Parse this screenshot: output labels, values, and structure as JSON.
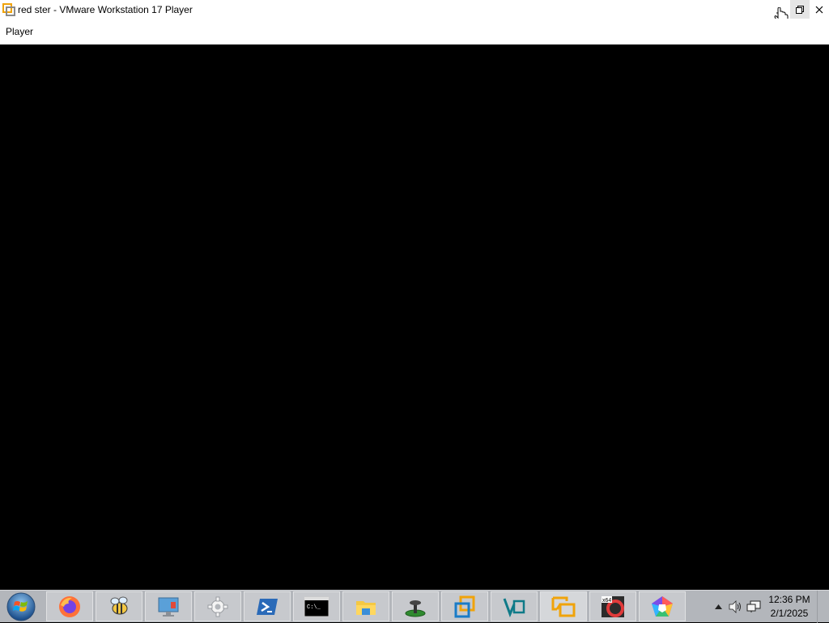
{
  "window": {
    "title": "red ster - VMware Workstation 17 Player",
    "icon": "vmware-logo-icon",
    "controls": [
      "minimize-icon",
      "maximize-icon",
      "close-icon"
    ]
  },
  "menubar": {
    "player_label": "Player"
  },
  "vm_screen": {
    "background": "#000000"
  },
  "taskbar": {
    "start_icon": "windows-start-orb-icon",
    "apps": [
      {
        "name": "firefox",
        "icon": "firefox-icon"
      },
      {
        "name": "bee",
        "icon": "bee-app-icon"
      },
      {
        "name": "computer",
        "icon": "computer-monitor-icon"
      },
      {
        "name": "settings",
        "icon": "gear-icon"
      },
      {
        "name": "powershell",
        "icon": "powershell-icon"
      },
      {
        "name": "cmd",
        "icon": "command-prompt-icon"
      },
      {
        "name": "explorer",
        "icon": "file-explorer-icon"
      },
      {
        "name": "stand",
        "icon": "green-stand-icon"
      },
      {
        "name": "virtualbox",
        "icon": "overlapping-squares-icon"
      },
      {
        "name": "visualstudio",
        "icon": "vs-logo-icon"
      },
      {
        "name": "vmware",
        "icon": "vmware-logo-icon"
      },
      {
        "name": "x64dbg",
        "icon": "x64dbg-icon"
      },
      {
        "name": "colorful",
        "icon": "pentagon-app-icon"
      }
    ],
    "tray_icons": [
      "show-hidden-icons-chevron",
      "speaker-icon",
      "network-icon"
    ],
    "clock": {
      "time": "12:36 PM",
      "date": "2/1/2025"
    }
  },
  "colors": {
    "vmware_orange": "#f0a30a",
    "taskbar_bg": "#b3b6bb"
  }
}
